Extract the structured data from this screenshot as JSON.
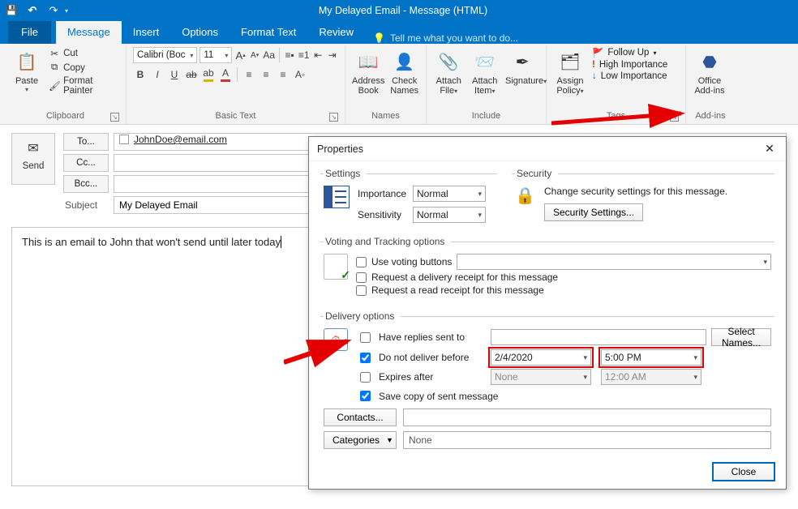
{
  "title_bar": {
    "title": "My Delayed Email  - Message (HTML)"
  },
  "tabs": {
    "file": "File",
    "message": "Message",
    "insert": "Insert",
    "options": "Options",
    "format_text": "Format Text",
    "review": "Review",
    "tell_me": "Tell me what you want to do..."
  },
  "ribbon": {
    "clipboard": {
      "paste": "Paste",
      "cut": "Cut",
      "copy": "Copy",
      "format_painter": "Format Painter",
      "label": "Clipboard"
    },
    "basic_text": {
      "font": "Calibri (Boc",
      "size": "11",
      "label": "Basic Text"
    },
    "names": {
      "address_book": "Address Book",
      "check_names": "Check Names",
      "label": "Names"
    },
    "include": {
      "attach_file": "Attach File",
      "attach_item": "Attach Item",
      "signature": "Signature",
      "label": "Include"
    },
    "tags": {
      "assign_policy": "Assign Policy",
      "follow_up": "Follow Up",
      "high": "High Importance",
      "low": "Low Importance",
      "label": "Tags"
    },
    "addins": {
      "office": "Office Add-ins",
      "label": "Add-ins"
    }
  },
  "compose": {
    "send": "Send",
    "to_btn": "To...",
    "cc_btn": "Cc...",
    "bcc_btn": "Bcc...",
    "subject_label": "Subject",
    "to_value": "JohnDoe@email.com",
    "cc_value": "",
    "bcc_value": "",
    "subject_value": "My Delayed Email",
    "body": "This is an email to John that won't send until later today"
  },
  "dialog": {
    "title": "Properties",
    "settings_legend": "Settings",
    "importance_label": "Importance",
    "importance_value": "Normal",
    "sensitivity_label": "Sensitivity",
    "sensitivity_value": "Normal",
    "security_legend": "Security",
    "security_text": "Change security settings for this message.",
    "security_btn": "Security Settings...",
    "voting_legend": "Voting and Tracking options",
    "use_voting": "Use voting buttons",
    "delivery_receipt": "Request a delivery receipt for this message",
    "read_receipt": "Request a read receipt for this message",
    "delivery_legend": "Delivery options",
    "have_replies": "Have replies sent to",
    "select_names": "Select Names...",
    "do_not_deliver": "Do not deliver before",
    "dnd_date": "2/4/2020",
    "dnd_time": "5:00 PM",
    "expires_after": "Expires after",
    "exp_date": "None",
    "exp_time": "12:00 AM",
    "save_copy": "Save copy of sent message",
    "contacts_btn": "Contacts...",
    "categories_btn": "Categories",
    "categories_value": "None",
    "close": "Close"
  }
}
